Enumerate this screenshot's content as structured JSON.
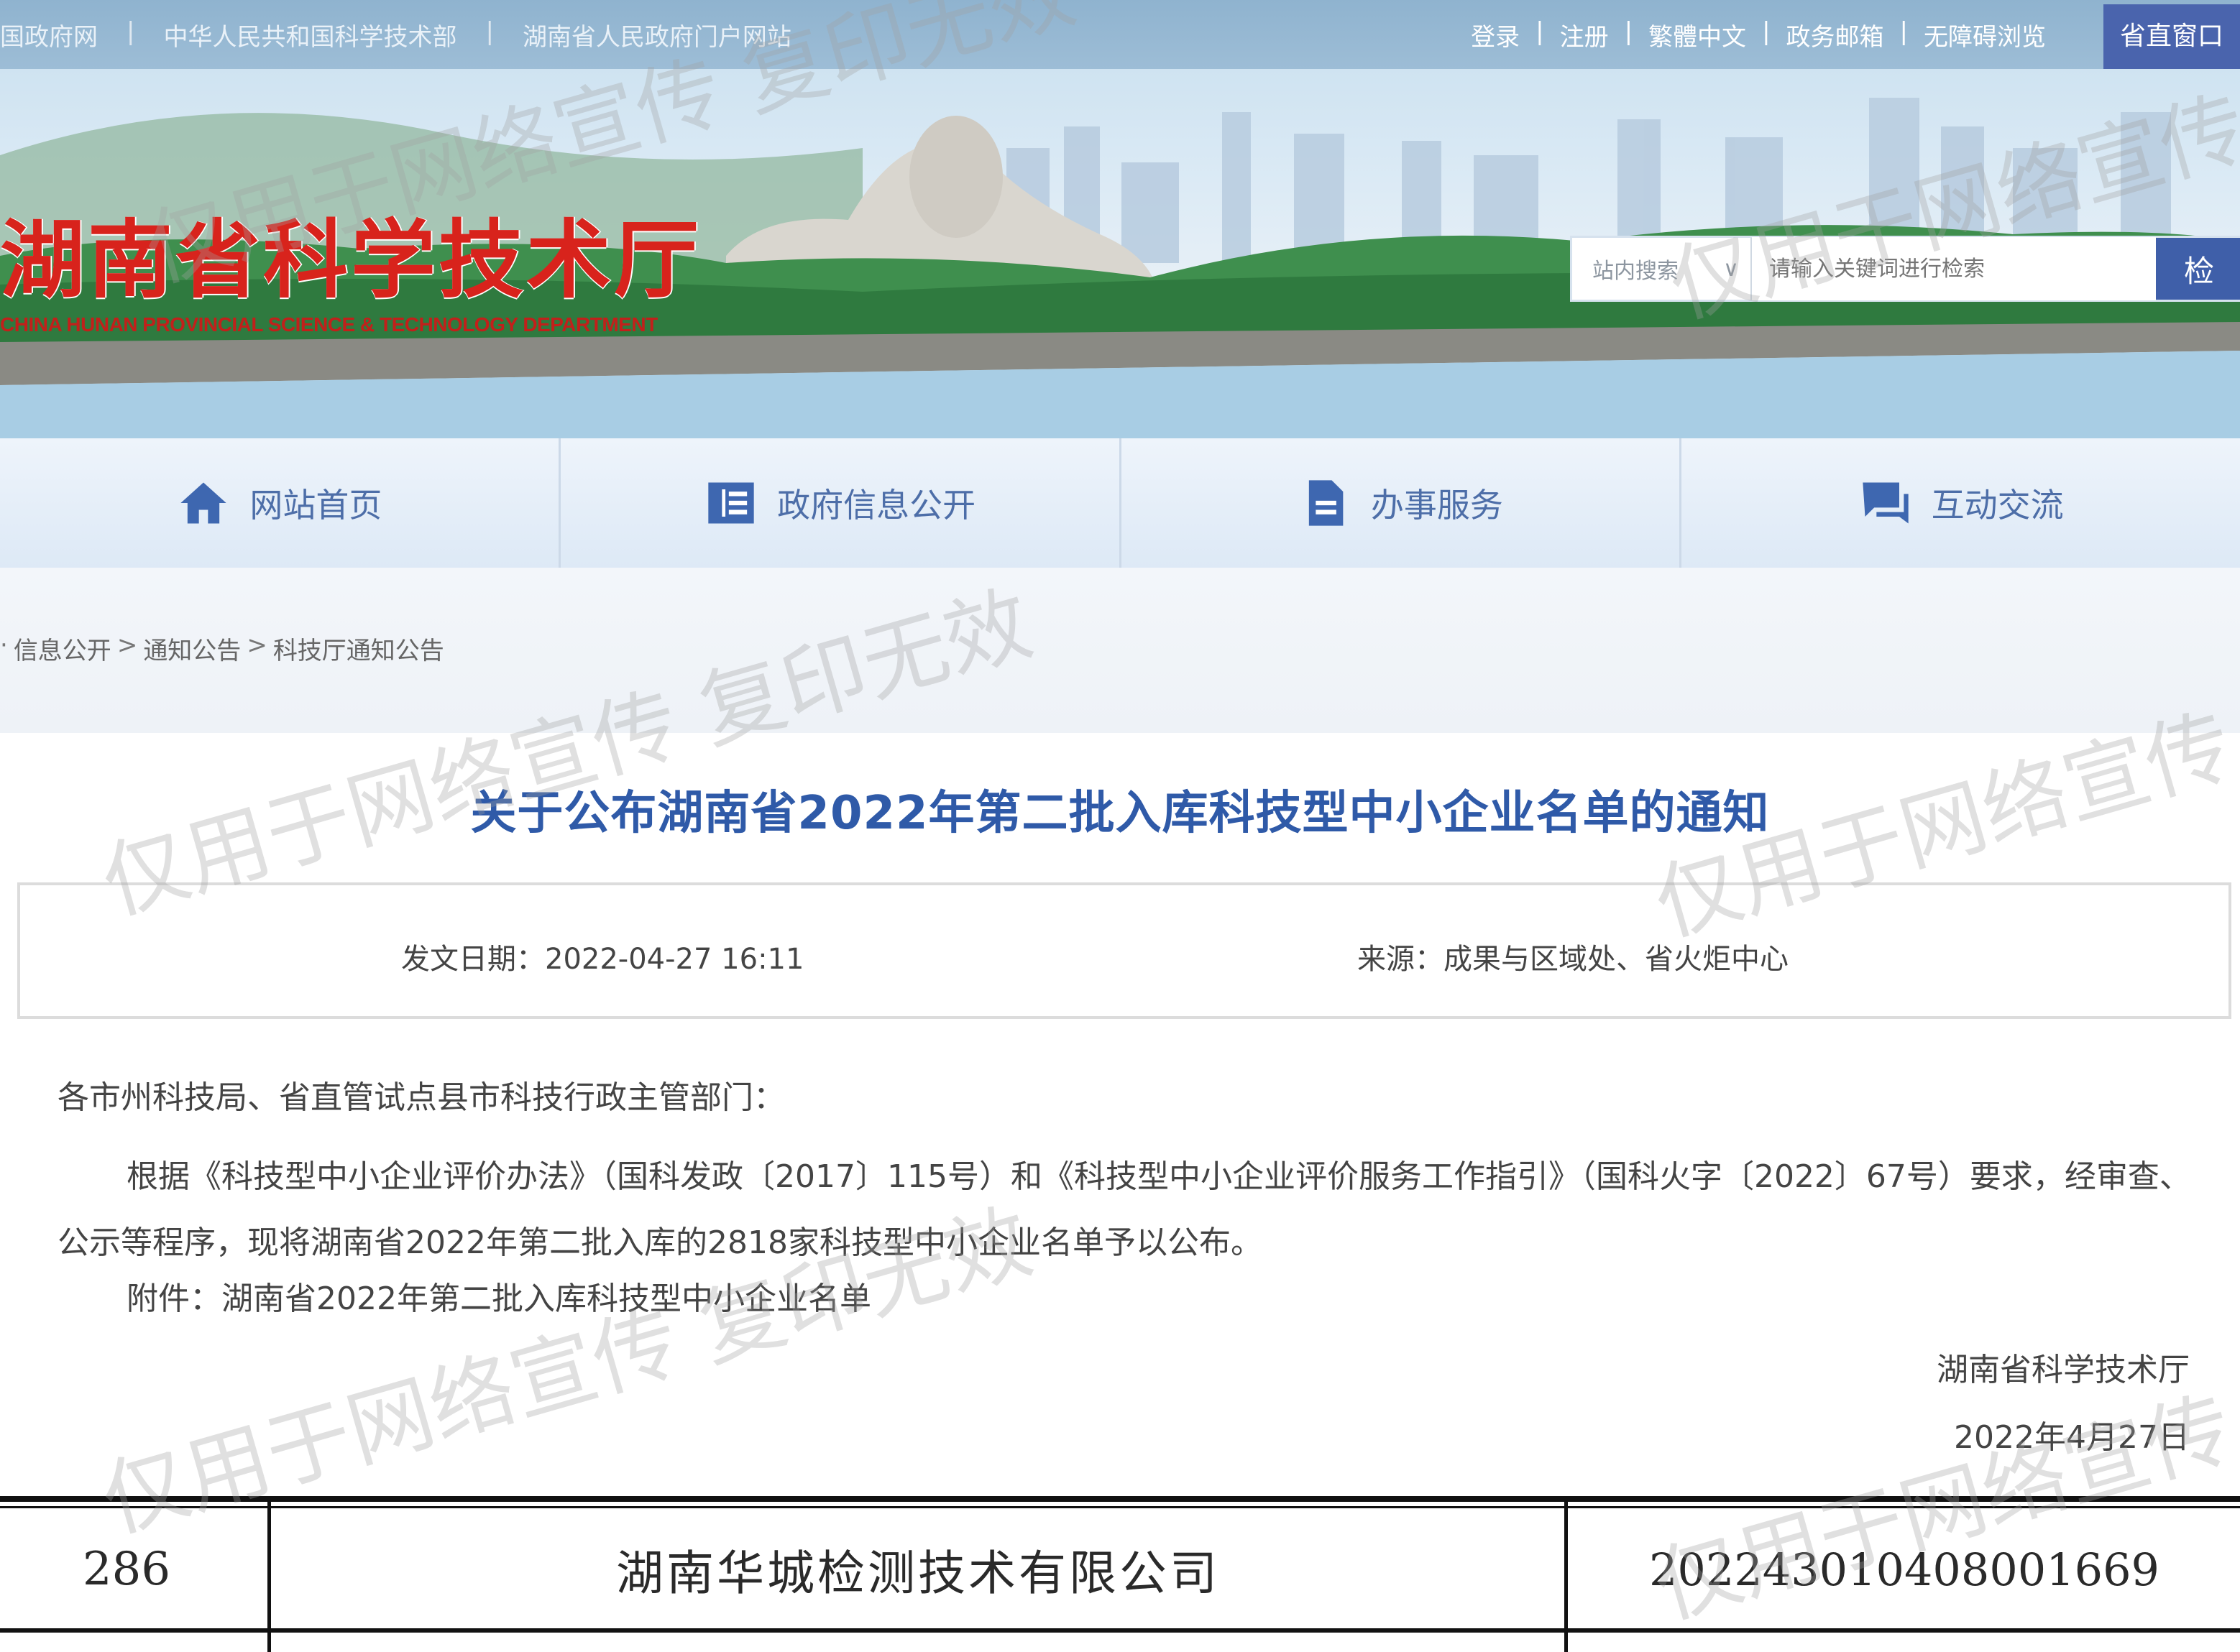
{
  "topbar": {
    "left_links": [
      "国政府网",
      "中华人民共和国科学技术部",
      "湖南省人民政府门户网站"
    ],
    "right_links": [
      "登录",
      "注册",
      "繁體中文",
      "政务邮箱",
      "无障碍浏览"
    ],
    "portal_button": "省直窗口"
  },
  "banner": {
    "title": "湖南省科学技术厅",
    "subtitle": "CHINA HUNAN PROVINCIAL SCIENCE & TECHNOLOGY DEPARTMENT"
  },
  "search": {
    "scope": "站内搜索",
    "placeholder": "请输入关键词进行检索",
    "button": "检"
  },
  "nav": {
    "items": [
      {
        "label": "网站首页",
        "icon": "home-icon"
      },
      {
        "label": "政府信息公开",
        "icon": "info-panel-icon"
      },
      {
        "label": "办事服务",
        "icon": "document-icon"
      },
      {
        "label": "互动交流",
        "icon": "chat-icon"
      }
    ]
  },
  "breadcrumb": [
    "信息公开",
    "通知公告",
    "科技厅通知公告"
  ],
  "article": {
    "title": "关于公布湖南省2022年第二批入库科技型中小企业名单的通知",
    "date": "发文日期：2022-04-27 16:11",
    "source": "来源：成果与区域处、省火炬中心",
    "salutation": "各市州科技局、省直管试点县市科技行政主管部门：",
    "body": "根据《科技型中小企业评价办法》（国科发政〔2017〕115号）和《科技型中小企业评价服务工作指引》（国科火字〔2022〕67号）要求，经审查、公示等程序，现将湖南省2022年第二批入库的2818家科技型中小企业名单予以公布。",
    "attachment": "附件：湖南省2022年第二批入库科技型中小企业名单",
    "signature_org": "湖南省科学技术厅",
    "signature_date": "2022年4月27日"
  },
  "table_row": {
    "number": "286",
    "company": "湖南华城检测技术有限公司",
    "code": "202243010408001669"
  },
  "watermark_text": "仅用于网络宣传 复印无效",
  "colors": {
    "title_red": "#d8231c",
    "nav_blue": "#4d6ea8",
    "article_title_blue": "#2f5aa8",
    "search_button": "#3f5fa9"
  }
}
